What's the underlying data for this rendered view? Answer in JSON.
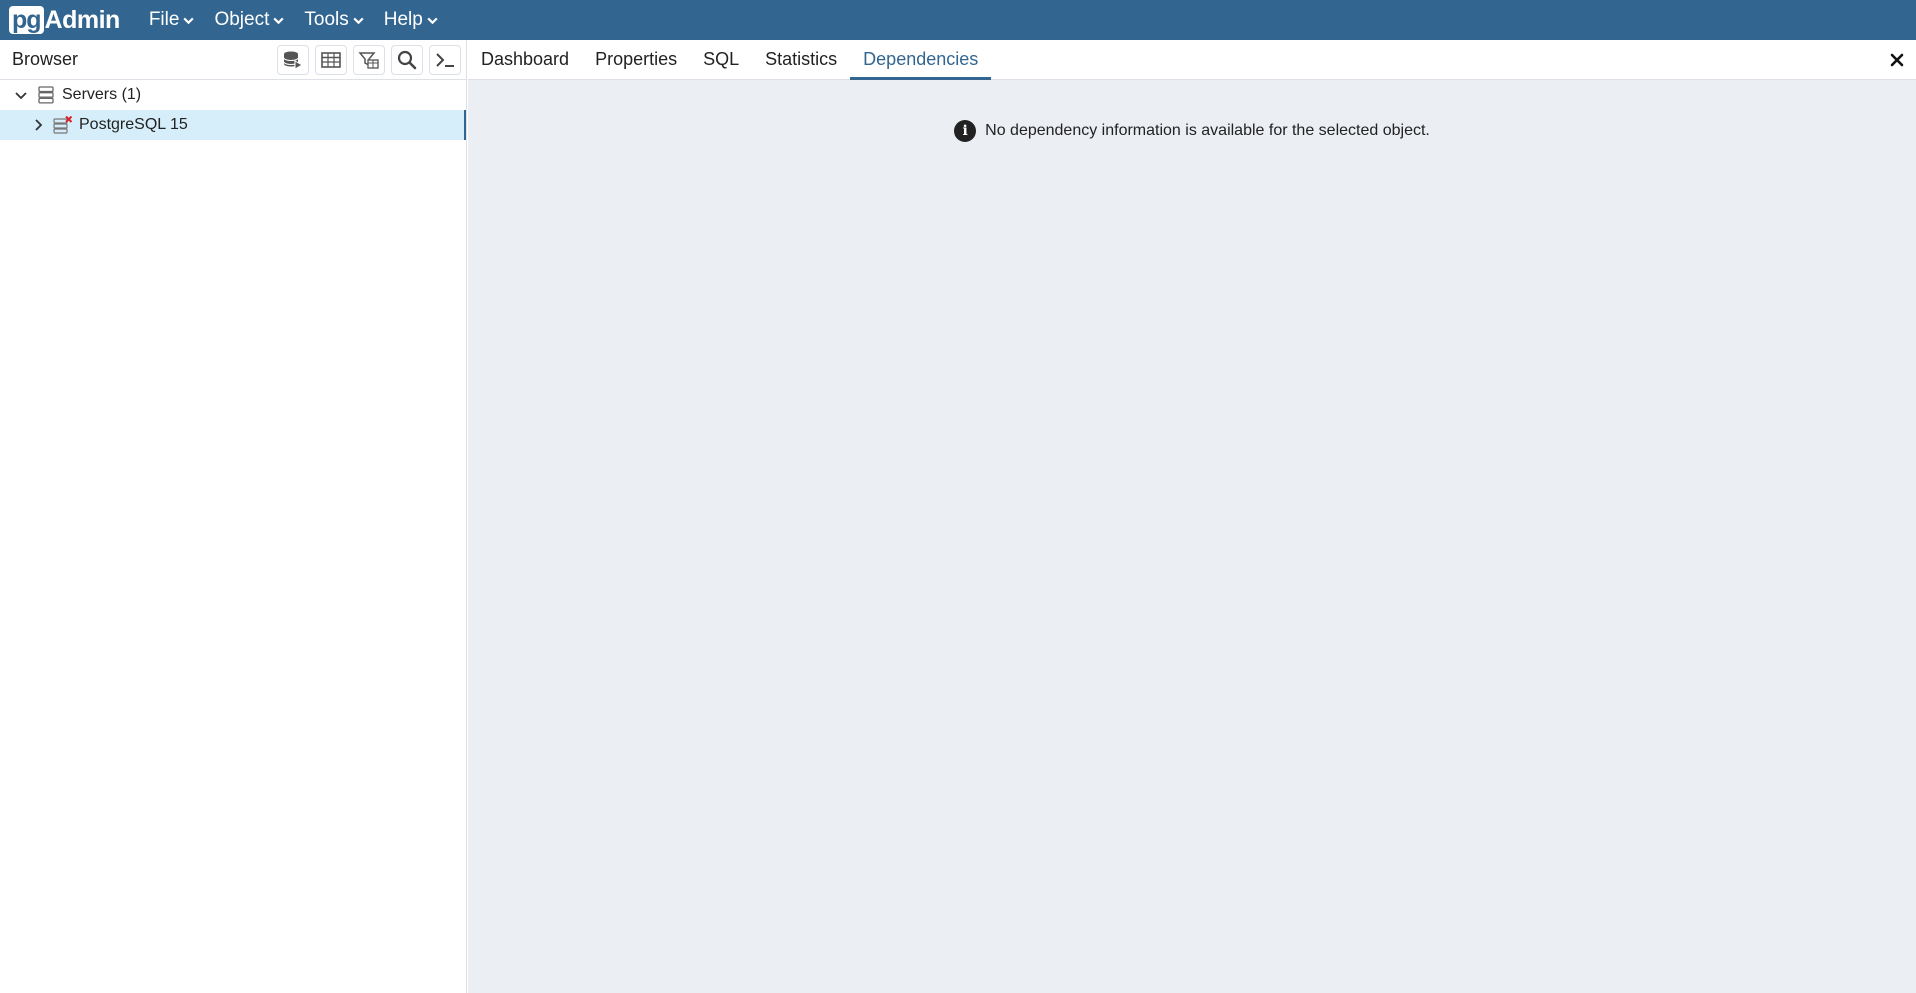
{
  "app": {
    "logo_pg": "pg",
    "logo_admin": "Admin"
  },
  "menu": [
    {
      "label": "File"
    },
    {
      "label": "Object"
    },
    {
      "label": "Tools"
    },
    {
      "label": "Help"
    }
  ],
  "browser": {
    "title": "Browser",
    "toolbar": [
      {
        "icon": "query-tool-icon"
      },
      {
        "icon": "view-data-icon"
      },
      {
        "icon": "filtered-rows-icon"
      },
      {
        "icon": "search-objects-icon"
      },
      {
        "icon": "psql-tool-icon"
      }
    ],
    "tree": [
      {
        "label": "Servers (1)",
        "icon": "servers-icon",
        "expanded": true
      },
      {
        "label": "PostgreSQL 15",
        "icon": "server-disconnected-icon",
        "expanded": false,
        "selected": true
      }
    ]
  },
  "tabs": [
    {
      "label": "Dashboard"
    },
    {
      "label": "Properties"
    },
    {
      "label": "SQL"
    },
    {
      "label": "Statistics"
    },
    {
      "label": "Dependencies",
      "active": true
    }
  ],
  "content": {
    "info_message": "No dependency information is available for the selected object."
  },
  "colors": {
    "brand": "#326690",
    "selection": "#d6eefa",
    "content_bg": "#ebeef3"
  }
}
